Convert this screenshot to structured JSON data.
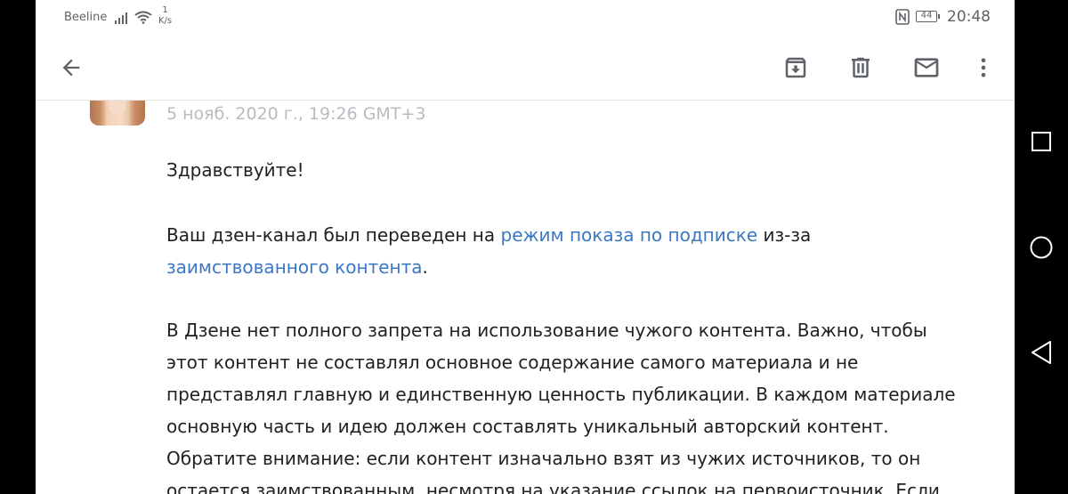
{
  "status_bar": {
    "carrier": "Beeline",
    "speed_value": "1",
    "speed_unit": "K/s",
    "battery": "44",
    "time": "20:48"
  },
  "icons": {
    "back": "arrow-back-icon",
    "archive": "archive-icon",
    "delete": "trash-icon",
    "mark_unread": "mail-icon",
    "more": "more-vert-icon",
    "nav_recent": "square-icon",
    "nav_home": "circle-icon",
    "nav_back": "triangle-back-icon"
  },
  "colors": {
    "link": "#3b78c4",
    "text": "#202124",
    "meta": "#b8bcc1"
  },
  "message": {
    "date": "5 нояб. 2020 г., 19:26 GMT+3",
    "greeting": "Здравствуйте!",
    "p1_before": "Ваш дзен-канал был переведен на ",
    "p1_link1": "режим показа по подписке",
    "p1_mid": " из-за",
    "p1_link2": "заимствованного контента",
    "p1_after": ".",
    "p2_lines": [
      "В Дзене нет полного запрета на использование чужого контента. Важно, чтобы",
      "этот контент не составлял основное содержание самого материала и не",
      "представлял главную и единственную ценность публикации. В каждом материале",
      "основную часть и идею должен составлять уникальный авторский контент.",
      "Обратите внимание: если контент изначально взят из чужих источников, то он",
      "остается заимствованным, несмотря на указание ссылок на первоисточник. Если"
    ]
  }
}
